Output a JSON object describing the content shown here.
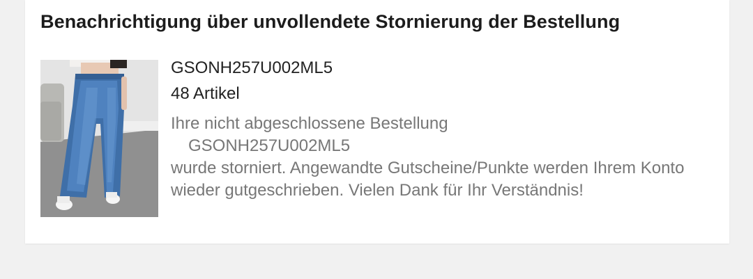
{
  "notification": {
    "title": "Benachrichtigung über unvollendete Stornierung der Bestellung",
    "order_id": "GSONH257U002ML5",
    "item_count": "48 Artikel",
    "message_line1": "Ihre nicht abgeschlossene Bestellung",
    "message_order_id": "GSONH257U002ML5",
    "message_line3": "wurde storniert. Angewandte Gutscheine/Punkte werden Ihrem Konto",
    "message_line4": "wieder gutgeschrieben. Vielen Dank für Ihr Verständnis!",
    "product_image": "jeans-product-photo"
  },
  "colors": {
    "page_background": "#f1f1f1",
    "card_background": "#ffffff",
    "title_text": "#1c1c1c",
    "message_text": "#777777"
  }
}
